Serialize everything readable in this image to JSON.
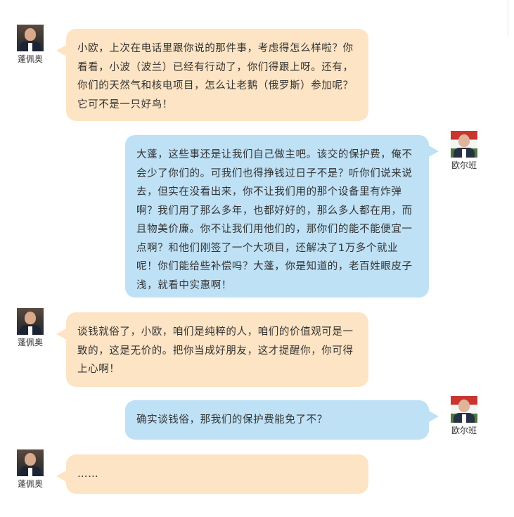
{
  "participants": {
    "left": {
      "name": "蓬佩奥",
      "avatar_icon": "person-portrait-icon"
    },
    "right": {
      "name": "欧尔班",
      "avatar_icon": "person-portrait-flag-icon"
    }
  },
  "colors": {
    "left_bubble": "#fde4c4",
    "right_bubble": "#bfe1f6",
    "text": "#333333"
  },
  "messages": [
    {
      "side": "left",
      "sender": "蓬佩奥",
      "text": "小欧，上次在电话里跟你说的那件事，考虑得怎么样啦？你看看，小波（波兰）已经有行动了，你们得跟上呀。还有，你们的天然气和核电项目，怎么让老鹅（俄罗斯）参加呢？它可不是一只好鸟！"
    },
    {
      "side": "right",
      "sender": "欧尔班",
      "text": "大蓬，这些事还是让我们自己做主吧。该交的保护费，俺不会少了你们的。可我们也得挣钱过日子不是？听你们说来说去，但实在没看出来，你不让我们用的那个设备里有炸弹啊？我们用了那么多年，也都好好的，那么多人都在用，而且物美价廉。你不让我们用他们的，那你们的能不能便宜一点啊？和他们刚签了一个大项目，还解决了1万多个就业呢！你们能给些补偿吗？大蓬，你是知道的，老百姓眼皮子浅，就看中实惠啊！"
    },
    {
      "side": "left",
      "sender": "蓬佩奥",
      "text": "谈钱就俗了，小欧，咱们是纯粹的人，咱们的价值观可是一致的，这是无价的。把你当成好朋友，这才提醒你，你可得上心啊！"
    },
    {
      "side": "right",
      "sender": "欧尔班",
      "text": "确实谈钱俗，那我们的保护费能免了不？"
    },
    {
      "side": "left",
      "sender": "蓬佩奥",
      "text": "……"
    }
  ]
}
